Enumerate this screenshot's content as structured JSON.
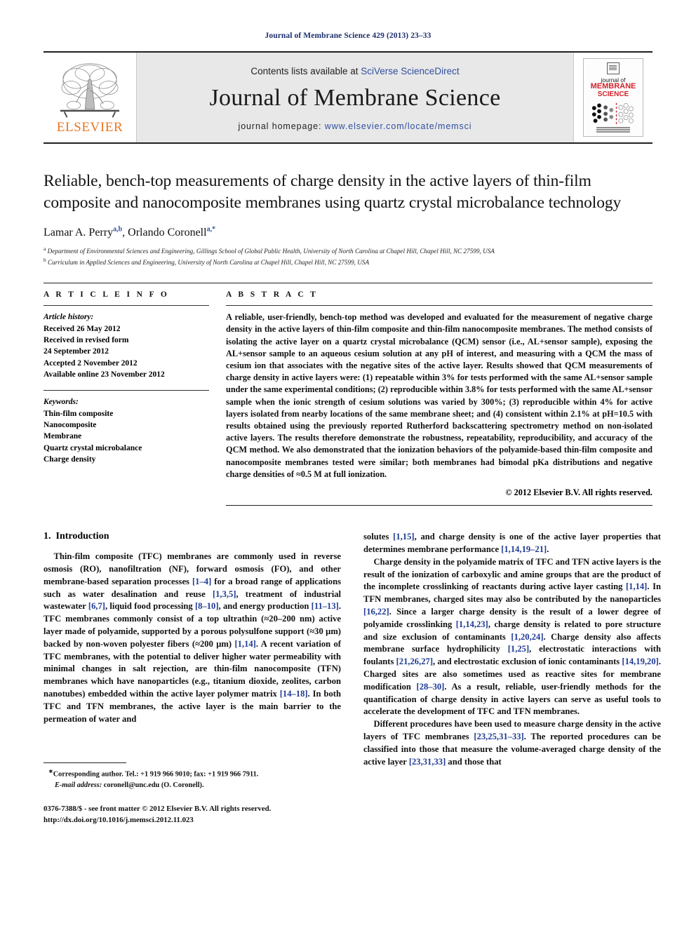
{
  "running_head": "Journal of Membrane Science 429 (2013) 23–33",
  "masthead": {
    "publisher_name": "ELSEVIER",
    "contents_prefix": "Contents lists available at ",
    "contents_link": "SciVerse ScienceDirect",
    "journal_title": "Journal of Membrane Science",
    "homepage_prefix": "journal homepage: ",
    "homepage_url": "www.elsevier.com/locate/memsci",
    "cover": {
      "line1": "journal of",
      "line2": "MEMBRANE",
      "line3": "SCIENCE"
    },
    "link_color": "#2f4fa0",
    "elsevier_orange": "#E87722",
    "cover_red": "#d2232a"
  },
  "article": {
    "title": "Reliable, bench-top measurements of charge density in the active layers of thin-film composite and nanocomposite membranes using quartz crystal microbalance technology",
    "authors_html": "Lamar A. Perry<sup>a,b</sup>, Orlando Coronell<sup>a,*</sup>",
    "affiliations": [
      "a Department of Environmental Sciences and Engineering, Gillings School of Global Public Health, University of North Carolina at Chapel Hill, Chapel Hill, NC 27599, USA",
      "b Curriculum in Applied Sciences and Engineering, University of North Carolina at Chapel Hill, Chapel Hill, NC 27599, USA"
    ],
    "affil_markers": [
      "a",
      "b"
    ],
    "affil_texts": [
      "Department of Environmental Sciences and Engineering, Gillings School of Global Public Health, University of North Carolina at Chapel Hill, Chapel Hill, NC 27599, USA",
      "Curriculum in Applied Sciences and Engineering, University of North Carolina at Chapel Hill, Chapel Hill, NC 27599, USA"
    ]
  },
  "article_info": {
    "label": "A R T I C L E    I N F O",
    "history_heading": "Article history:",
    "history_lines": [
      "Received 26 May 2012",
      "Received in revised form",
      "24 September 2012",
      "Accepted 2 November 2012",
      "Available online 23 November 2012"
    ],
    "keywords_heading": "Keywords:",
    "keywords": [
      "Thin-film composite",
      "Nanocomposite",
      "Membrane",
      "Quartz crystal microbalance",
      "Charge density"
    ]
  },
  "abstract": {
    "label": "A B S T R A C T",
    "text": "A reliable, user-friendly, bench-top method was developed and evaluated for the measurement of negative charge density in the active layers of thin-film composite and thin-film nanocomposite membranes. The method consists of isolating the active layer on a quartz crystal microbalance (QCM) sensor (i.e., AL+sensor sample), exposing the AL+sensor sample to an aqueous cesium solution at any pH of interest, and measuring with a QCM the mass of cesium ion that associates with the negative sites of the active layer. Results showed that QCM measurements of charge density in active layers were: (1) repeatable within 3% for tests performed with the same AL+sensor sample under the same experimental conditions; (2) reproducible within 3.8% for tests performed with the same AL+sensor sample when the ionic strength of cesium solutions was varied by 300%; (3) reproducible within 4% for active layers isolated from nearby locations of the same membrane sheet; and (4) consistent within 2.1% at pH=10.5 with results obtained using the previously reported Rutherford backscattering spectrometry method on non-isolated active layers. The results therefore demonstrate the robustness, repeatability, reproducibility, and accuracy of the QCM method. We also demonstrated that the ionization behaviors of the polyamide-based thin-film composite and nanocomposite membranes tested were similar; both membranes had bimodal pKa distributions and negative charge densities of ≈0.5 M at full ionization.",
    "copyright": "© 2012 Elsevier B.V. All rights reserved."
  },
  "introduction": {
    "number": "1.",
    "heading": "Introduction",
    "left_paragraphs": [
      "Thin-film composite (TFC) membranes are commonly used in reverse osmosis (RO), nanofiltration (NF), forward osmosis (FO), and other membrane-based separation processes [1–4] for a broad range of applications such as water desalination and reuse [1,3,5], treatment of industrial wastewater [6,7], liquid food processing [8–10], and energy production [11–13]. TFC membranes commonly consist of a top ultrathin (≈20–200 nm) active layer made of polyamide, supported by a porous polysulfone support (≈30 μm) backed by non-woven polyester fibers (≈200 μm) [1,14]. A recent variation of TFC membranes, with the potential to deliver higher water permeability with minimal changes in salt rejection, are thin-film nanocomposite (TFN) membranes which have nanoparticles (e.g., titanium dioxide, zeolites, carbon nanotubes) embedded within the active layer polymer matrix [14–18]. In both TFC and TFN membranes, the active layer is the main barrier to the permeation of water and"
    ],
    "right_paragraphs": [
      "solutes [1,15], and charge density is one of the active layer properties that determines membrane performance [1,14,19–21].",
      "Charge density in the polyamide matrix of TFC and TFN active layers is the result of the ionization of carboxylic and amine groups that are the product of the incomplete crosslinking of reactants during active layer casting [1,14]. In TFN membranes, charged sites may also be contributed by the nanoparticles [16,22]. Since a larger charge density is the result of a lower degree of polyamide crosslinking [1,14,23], charge density is related to pore structure and size exclusion of contaminants [1,20,24]. Charge density also affects membrane surface hydrophilicity [1,25], electrostatic interactions with foulants [21,26,27], and electrostatic exclusion of ionic contaminants [14,19,20]. Charged sites are also sometimes used as reactive sites for membrane modification [28–30]. As a result, reliable, user-friendly methods for the quantification of charge density in active layers can serve as useful tools to accelerate the development of TFC and TFN membranes.",
      "Different procedures have been used to measure charge density in the active layers of TFC membranes [23,25,31–33]. The reported procedures can be classified into those that measure the volume-averaged charge density of the active layer [23,31,33] and those that"
    ]
  },
  "footnote": {
    "corresponding": "Corresponding author. Tel.: +1 919 966 9010; fax: +1 919 966 7911.",
    "email_label": "E-mail address:",
    "email_value": "coronell@unc.edu (O. Coronell).",
    "issn_line": "0376-7388/$ - see front matter © 2012 Elsevier B.V. All rights reserved.",
    "doi_line": "http://dx.doi.org/10.1016/j.memsci.2012.11.023"
  }
}
